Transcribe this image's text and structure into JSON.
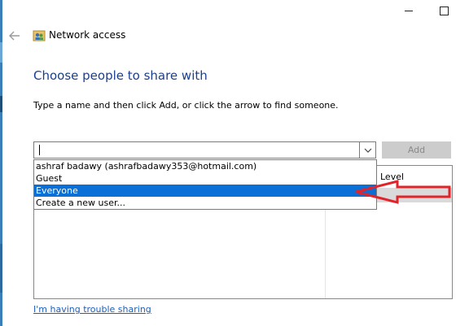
{
  "window": {
    "title": "Network access",
    "back_icon": "back-arrow-icon",
    "app_icon": "network-people-icon"
  },
  "main": {
    "heading": "Choose people to share with",
    "instruction": "Type a name and then click Add, or click the arrow to find someone.",
    "name_input": {
      "value": "",
      "placeholder": ""
    },
    "add_label": "Add",
    "columns": {
      "permission_level": "Level"
    },
    "dropdown_options": [
      "ashraf badawy (ashrafbadawy353@hotmail.com)",
      "Guest",
      "Everyone",
      "Create a new user..."
    ],
    "selected_option": "Everyone",
    "trouble_link": "I'm having trouble sharing"
  },
  "colors": {
    "heading": "#1b3e8f",
    "selection": "#0a6fd6",
    "annotation_arrow": "#e0242a",
    "link": "#1e5db8"
  }
}
